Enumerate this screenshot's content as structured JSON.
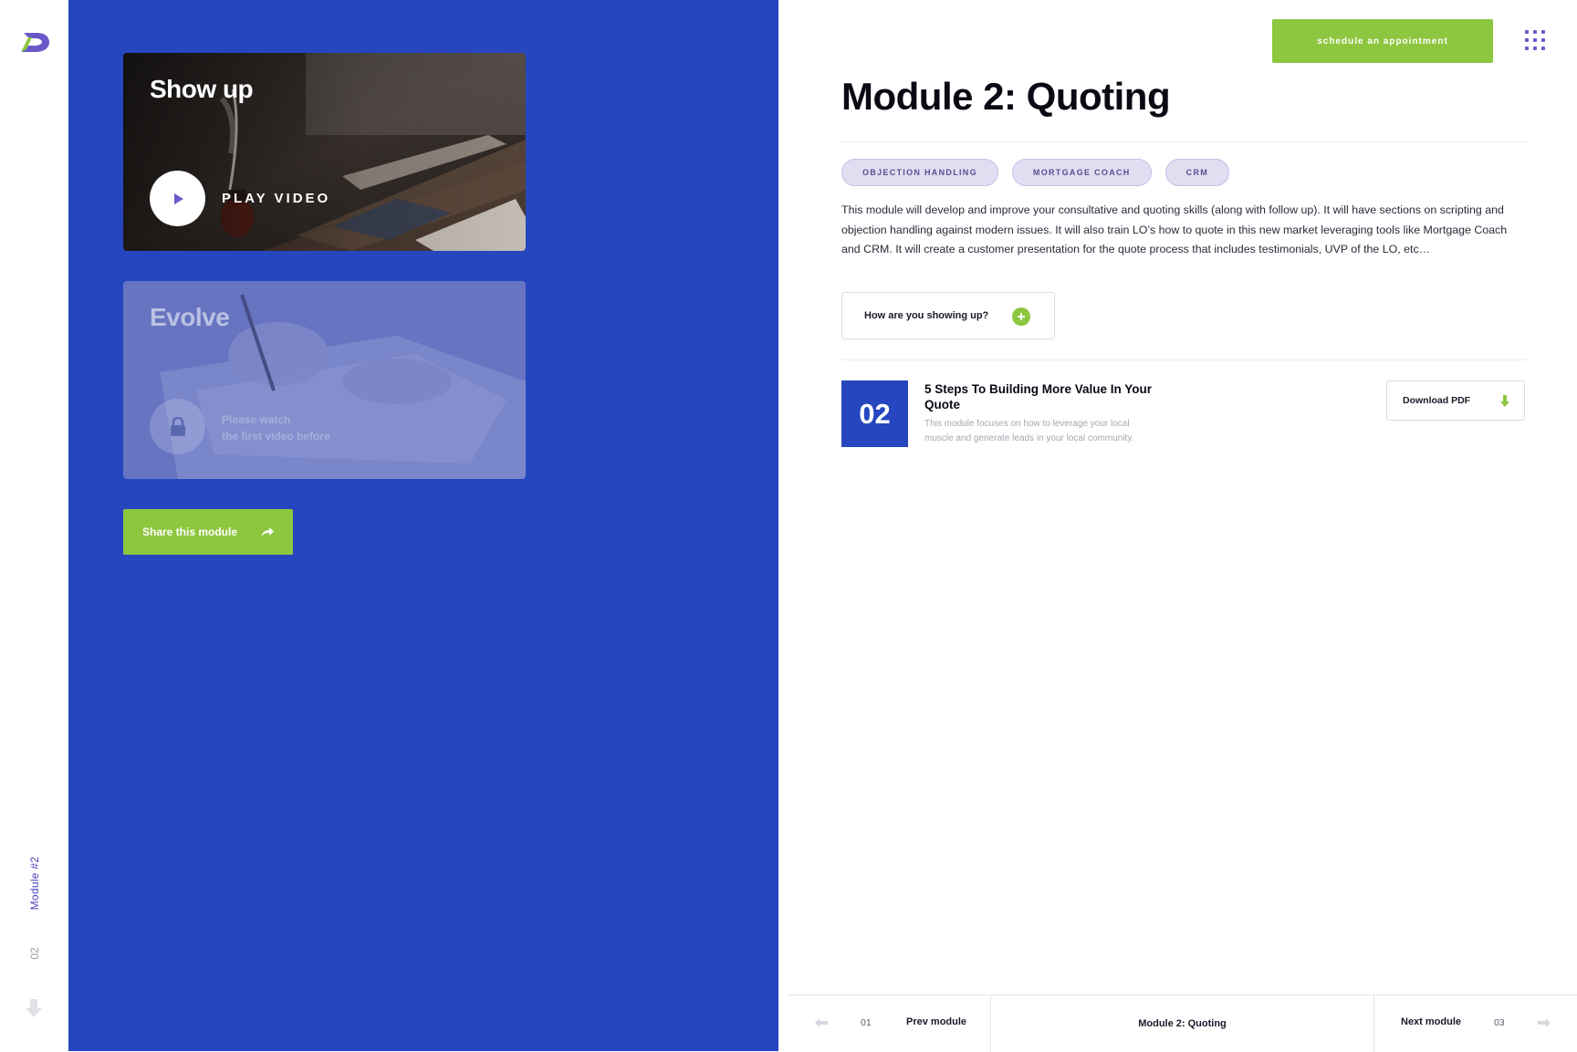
{
  "colors": {
    "brand_blue": "#2546bf",
    "accent_green": "#8dc63f",
    "tag_bg": "#e3ddf2",
    "logo_purple": "#6a58c8"
  },
  "rail": {
    "logo_icon": "brand-logo",
    "module_label": "Module #2",
    "module_number": "02",
    "scroll_icon": "arrow-down-icon"
  },
  "videos": [
    {
      "title": "Show up",
      "action_label": "PLAY VIDEO",
      "action_icon": "play-icon",
      "locked": false
    },
    {
      "title": "Evolve",
      "locked_text_line1": "Please watch",
      "locked_text_line2": "the first video before",
      "action_icon": "lock-icon",
      "locked": true
    }
  ],
  "share": {
    "label": "Share this module",
    "icon": "share-arrow-icon"
  },
  "header": {
    "schedule_label": "schedule an appointment",
    "menu_icon": "grid-menu-icon"
  },
  "module": {
    "title": "Module 2: Quoting",
    "tags": [
      "OBJECTION HANDLING",
      "MORTGAGE COACH",
      "CRM"
    ],
    "description": "This module will develop and improve your consultative and quoting skills (along with follow up). It will have sections on scripting and objection handling against modern issues. It will also train LO’s how to quote in this new market leveraging tools like Mortgage Coach and CRM. It will create a customer presentation for the quote process that includes testimonials, UVP of the LO, etc…",
    "showup_label": "How are you showing up?",
    "showup_icon": "plus-circle-icon"
  },
  "lesson": {
    "number": "02",
    "title": "5 Steps To Building More Value In Your Quote",
    "description": "This module focuses on how to leverage your local muscle and generate leads in your local community.",
    "download_label": "Download PDF",
    "download_icon": "download-arrow-icon"
  },
  "bottom_nav": {
    "prev_number": "01",
    "prev_label": "Prev module",
    "current_label": "Module 2: Quoting",
    "next_label": "Next module",
    "next_number": "03"
  }
}
